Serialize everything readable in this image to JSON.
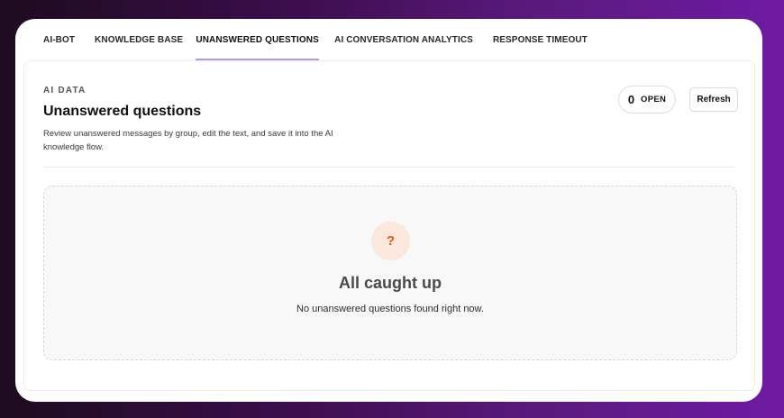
{
  "tabs": [
    {
      "label": "AI-BOT"
    },
    {
      "label": "KNOWLEDGE BASE"
    },
    {
      "label": "UNANSWERED QUESTIONS"
    },
    {
      "label": "AI CONVERSATION ANALYTICS"
    },
    {
      "label": "RESPONSE TIMEOUT"
    }
  ],
  "active_tab": "UNANSWERED QUESTIONS",
  "header": {
    "eyebrow": "AI DATA",
    "title": "Unanswered questions",
    "description": "Review unanswered messages by group, edit the text, and save it into the AI knowledge flow."
  },
  "open_badge": {
    "count": "0",
    "label": "OPEN"
  },
  "refresh_label": "Refresh",
  "empty_state": {
    "icon": "question-mark-icon",
    "icon_glyph": "?",
    "title": "All caught up",
    "subtitle": "No unanswered questions found right now."
  },
  "colors": {
    "accent_underline": "#b59ddc",
    "icon_bg": "#fbe7dc",
    "icon_fg": "#e0551e",
    "background_gradient_start": "#1e0b1f",
    "background_gradient_end": "#6f1aa3"
  }
}
